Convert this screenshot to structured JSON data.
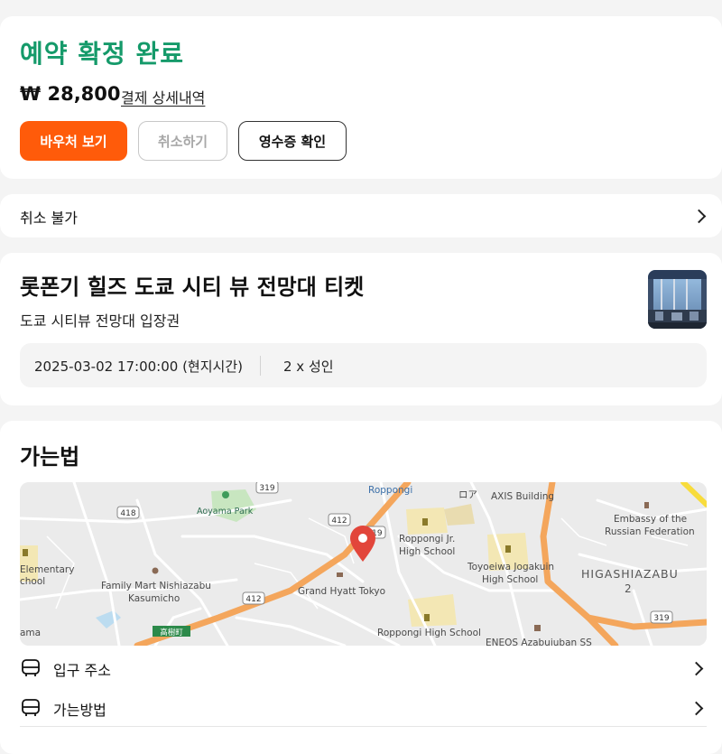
{
  "booking": {
    "status_title": "예약 확정 완료",
    "price": "₩ 28,800",
    "payment_details_link": "결제 상세내역",
    "buttons": {
      "voucher": "바우처 보기",
      "cancel": "취소하기",
      "receipt": "영수증 확인"
    }
  },
  "cancellation": {
    "label": "취소 불가"
  },
  "product": {
    "title": "롯폰기 힐즈 도쿄 시티 뷰 전망대 티켓",
    "subtitle": "도쿄 시티뷰 전망대 입장권",
    "datetime": "2025-03-02 17:00:00 (현지시간)",
    "quantity": "2 x 성인"
  },
  "directions": {
    "title": "가는법",
    "rows": [
      {
        "label": "입구 주소",
        "icon": "bus-icon"
      },
      {
        "label": "가는방법",
        "icon": "bus-icon"
      }
    ]
  },
  "map": {
    "labels": {
      "roppongi": "Roppongi",
      "axis": "AXIS Building",
      "ro": "ロア",
      "aoyama": "Aoyama Park",
      "embassy1": "Embassy of the",
      "embassy2": "Russian Federation",
      "roppongi_jr1": "Roppongi Jr.",
      "roppongi_jr2": "High School",
      "toyoeiwa1": "Toyoeiwa Jogakuin",
      "toyoeiwa2": "High School",
      "higashiazabu": "HIGASHIAZABU",
      "higashiazabu_num": "2",
      "elementary1": "Elementary",
      "elementary2": "chool",
      "family1": "Family Mart Nishiazabu",
      "family2": "Kasumicho",
      "grand_hyatt": "Grand Hyatt Tokyo",
      "roppongi_hs": "Roppongi High School",
      "eneos": "ENEOS Azabujuban SS",
      "kogaicho": "高樹町",
      "ama": "ama",
      "r319a": "319",
      "r319b": "319",
      "r319c": "319",
      "r418": "418",
      "r412a": "412",
      "r412b": "412"
    },
    "colors": {
      "expressway": "#f4a65c",
      "park": "#c8e6c0",
      "school": "#f3e7b4",
      "pin": "#e2463b"
    }
  },
  "colors": {
    "accent_green": "#159a6a",
    "primary_orange": "#ff5b0a"
  }
}
